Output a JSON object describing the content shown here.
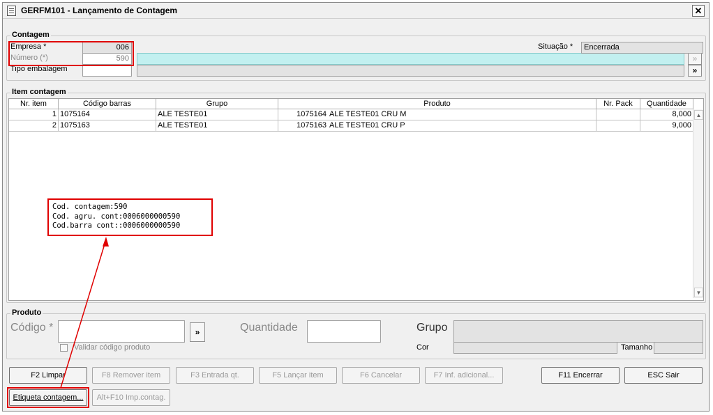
{
  "window": {
    "title": "GERFM101 - Lançamento de Contagem",
    "close_glyph": "✕"
  },
  "contagem": {
    "legend": "Contagem",
    "empresa_label": "Empresa *",
    "empresa_value": "006",
    "numero_label": "Número (*)",
    "numero_value": "590",
    "tipo_label": "Tipo embalagem",
    "tipo_value": "",
    "situacao_label": "Situação *",
    "situacao_value": "Encerrada",
    "search_glyph": "»"
  },
  "itens": {
    "legend": "Item contagem",
    "columns": [
      "Nr. item",
      "Código barras",
      "Grupo",
      "Produto",
      "Nr. Pack",
      "Quantidade"
    ],
    "rows": [
      {
        "nr": "1",
        "codigo": "1075164",
        "grupo": "ALE TESTE01",
        "prod_cod": "1075164",
        "prod_desc": "ALE TESTE01 CRU M",
        "pack": "",
        "qtd": "8,000"
      },
      {
        "nr": "2",
        "codigo": "1075163",
        "grupo": "ALE TESTE01",
        "prod_cod": "1075163",
        "prod_desc": "ALE TESTE01 CRU P",
        "pack": "",
        "qtd": "9,000"
      }
    ]
  },
  "annotation": {
    "lines": [
      "Cod. contagem:590",
      "Cod. agru. cont:0006000000590",
      "Cod.barra cont::0006000000590"
    ]
  },
  "produto": {
    "legend": "Produto",
    "codigo_label": "Código *",
    "codigo_value": "",
    "quantidade_label": "Quantidade",
    "quantidade_value": "",
    "grupo_label": "Grupo",
    "grupo_value": "",
    "cor_label": "Cor",
    "cor_value": "",
    "tamanho_label": "Tamanho",
    "tamanho_value": "",
    "validar_label": "Validar código produto",
    "validar_checked": false,
    "search_glyph": "»"
  },
  "buttons": {
    "limpar": "F2 Limpar",
    "remover": "F8 Remover item",
    "entrada": "F3 Entrada qt.",
    "lancar": "F5 Lançar item",
    "cancelar": "F6 Cancelar",
    "inf_adicional": "F7 Inf. adicional...",
    "encerrar": "F11 Encerrar",
    "sair": "ESC Sair",
    "etiqueta": "Etiqueta contagem...",
    "imp_contag": "Alt+F10 Imp.contag."
  },
  "colors": {
    "highlight": "#e00000",
    "cyan_field": "#c2f0f0",
    "window_bg": "#f0f0f0"
  }
}
